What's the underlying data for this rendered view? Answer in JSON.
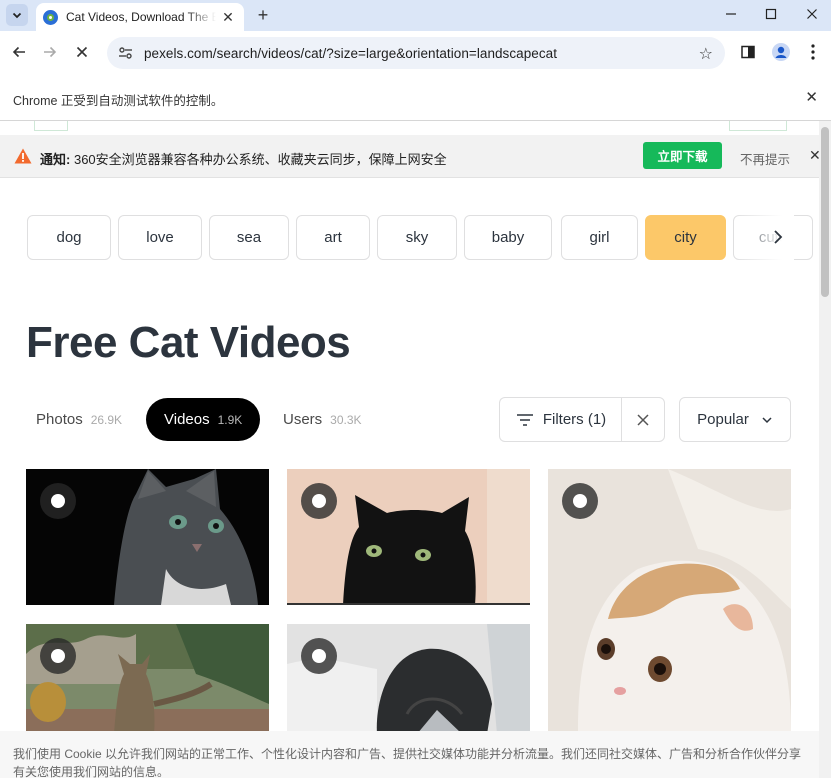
{
  "browser": {
    "tab_title": "Cat Videos, Download The BE",
    "url": "pexels.com/search/videos/cat/?size=large&orientation=landscapecat",
    "automation_message": "Chrome 正受到自动测试软件的控制。"
  },
  "notice": {
    "label": "通知:",
    "message": "360安全浏览器兼容各种办公系统、收藏夹云同步，保障上网安全",
    "download_label": "立即下载",
    "dismiss_label": "不再提示"
  },
  "chips": [
    "dog",
    "love",
    "sea",
    "art",
    "sky",
    "baby",
    "girl",
    "city",
    "cute"
  ],
  "active_chip": "city",
  "page": {
    "title": "Free Cat Videos",
    "tabs": [
      {
        "label": "Photos",
        "count": "26.9K"
      },
      {
        "label": "Videos",
        "count": "1.9K"
      },
      {
        "label": "Users",
        "count": "30.3K"
      }
    ],
    "filters_label": "Filters (1)",
    "sort_label": "Popular"
  },
  "cookie_text": "我们使用 Cookie 以允许我们网站的正常工作、个性化设计内容和广告、提供社交媒体功能并分析流量。我们还同社交媒体、广告和分析合作伙伴分享有关您使用我们网站的信息。",
  "colors": {
    "active_chip": "#fcc869",
    "notice_button": "#16b95a",
    "headline": "#2c343e"
  }
}
